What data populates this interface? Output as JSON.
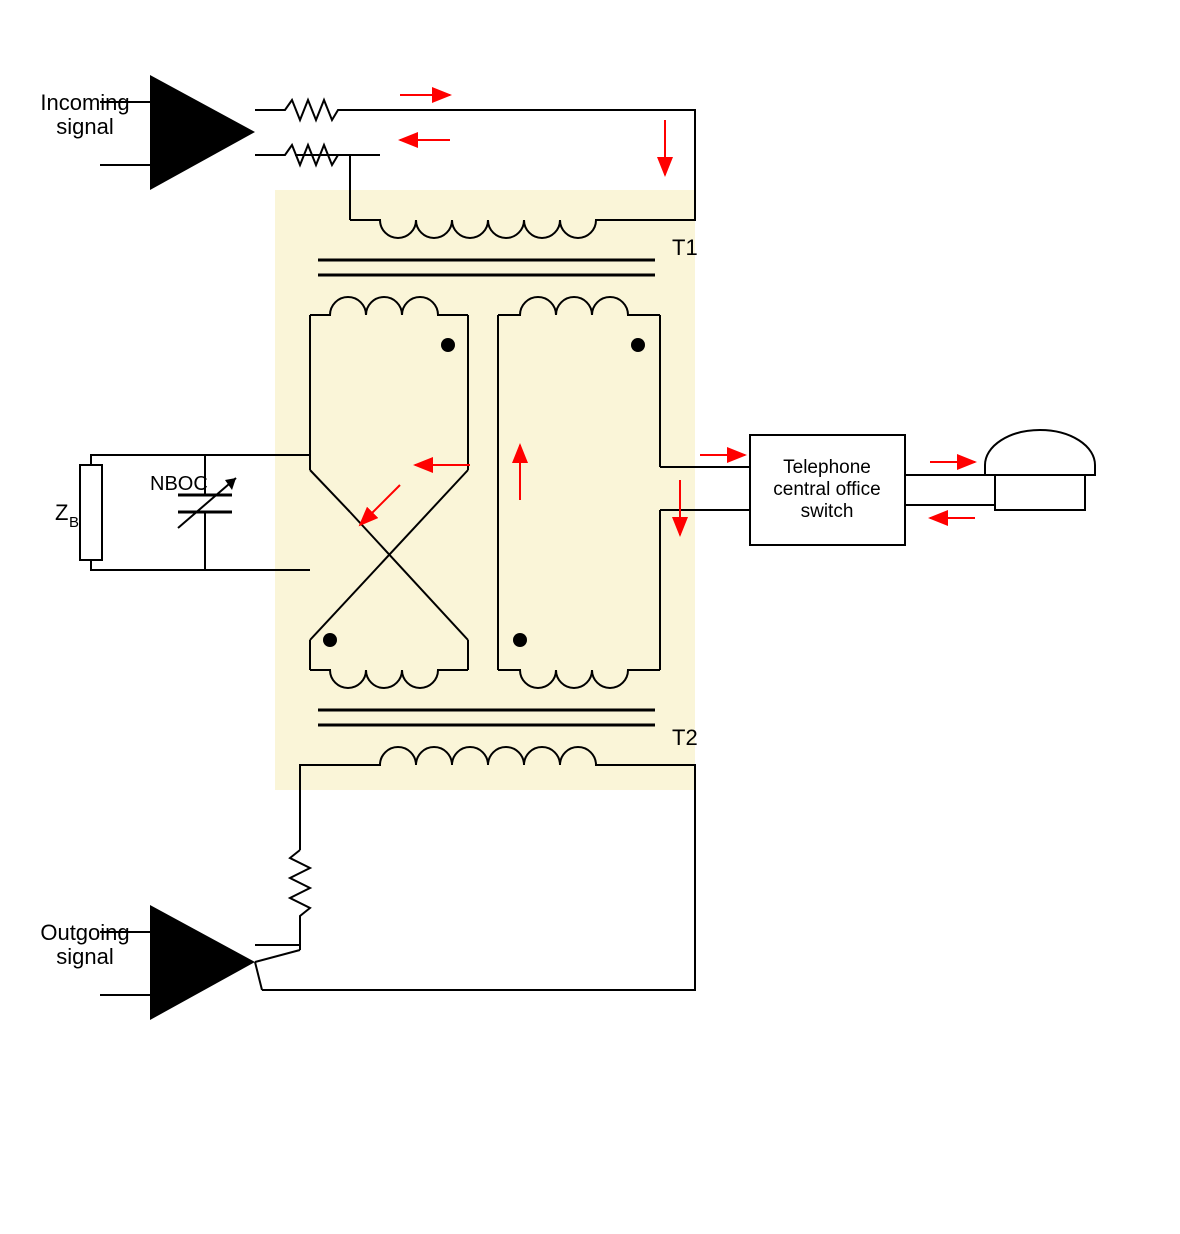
{
  "labels": {
    "incoming_line1": "Incoming",
    "incoming_line2": "signal",
    "outgoing_line1": "Outgoing",
    "outgoing_line2": "signal",
    "t1": "T1",
    "t2": "T2",
    "zb_z": "Z",
    "zb_b": "B",
    "nboc": "NBOC",
    "switch_line1": "Telephone",
    "switch_line2": "central office",
    "switch_line3": "switch"
  },
  "colors": {
    "bg_highlight": "#faf5d8",
    "arrow_red": "#ff0000",
    "stroke": "#000000"
  }
}
